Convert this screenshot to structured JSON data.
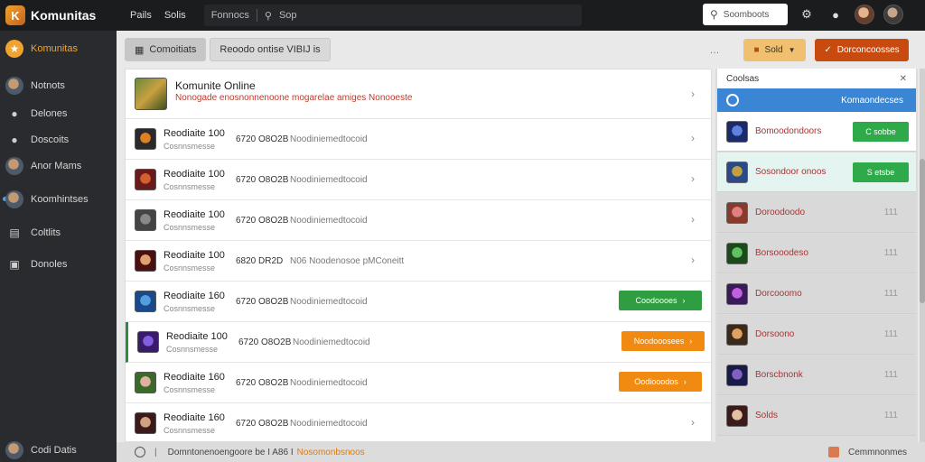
{
  "app": {
    "name": "Komunitas",
    "logo_letter": "K"
  },
  "topnav": [
    "Pails",
    "Solis",
    "Fonnocs"
  ],
  "topsearch": {
    "placeholder": "Sop"
  },
  "search": {
    "placeholder": "Soomboots"
  },
  "sidebar": {
    "items": [
      {
        "label": "Komunitas",
        "icon": "community-logo-icon"
      },
      {
        "label": "Notnots",
        "icon": "avatar-icon"
      },
      {
        "label": "Delones",
        "icon": "user-icon"
      },
      {
        "label": "Doscoits",
        "icon": "users-icon"
      },
      {
        "label": "Anor Mams",
        "icon": "avatar-icon"
      },
      {
        "label": "Koomhintses",
        "icon": "avatar-icon"
      },
      {
        "label": "Coltlits",
        "icon": "document-icon"
      },
      {
        "label": "Donoles",
        "icon": "folder-icon"
      }
    ],
    "footer": "Codi Datis"
  },
  "tabs": [
    {
      "label": "Comoitiats"
    },
    {
      "label": "Reoodo ontise VIBIJ is"
    }
  ],
  "header_buttons": {
    "sold_label": "Sold",
    "primary_label": "Dorconcoosses"
  },
  "main": {
    "title": "Komunite Online",
    "subtitle": "Nonogade enosnonnenoone mogarelae amiges Nonooeste",
    "rows": [
      {
        "name": "Reodiaite 100",
        "sub": "Cosnnsmesse",
        "time": "6720 O8O2B",
        "desc": "Noodiniemedtocoid",
        "button": null
      },
      {
        "name": "Reodiaite 100",
        "sub": "Cosnnsmesse",
        "time": "6720 O8O2B",
        "desc": "Noodiniemedtocoid",
        "button": null
      },
      {
        "name": "Reodiaite 100",
        "sub": "Cosnnsmesse",
        "time": "6720 O8O2B",
        "desc": "Noodiniemedtocoid",
        "button": null
      },
      {
        "name": "Reodiaite 100",
        "sub": "Cosnnsmesse",
        "time": "6820 DR2D",
        "desc": "N06 Noodenosoe pMConeitt",
        "button": null
      },
      {
        "name": "Reodiaite 160",
        "sub": "Cosnnsmesse",
        "time": "6720 O8O2B",
        "desc": "Noodiniemedtocoid",
        "button": {
          "label": "Coodoooes",
          "color": "#2e9e40"
        }
      },
      {
        "name": "Reodiaite 100",
        "sub": "Cosnnsmesse",
        "time": "6720 O8O2B",
        "desc": "Noodiniemedtocoid",
        "button": {
          "label": "Noodooosees",
          "color": "#f08a10"
        }
      },
      {
        "name": "Reodiaite 160",
        "sub": "Cosnnsmesse",
        "time": "6720 O8O2B",
        "desc": "Noodiniemedtocoid",
        "button": {
          "label": "Oodiooodos",
          "color": "#f08a10"
        }
      },
      {
        "name": "Reodiaite 160",
        "sub": "Cosnnsmesse",
        "time": "6720 O8O2B",
        "desc": "Noodiniemedtocoid",
        "button": null
      }
    ]
  },
  "right": {
    "head": "Coolsas",
    "blue_label": "Komaondecses",
    "items": [
      {
        "name": "Bomoodondoors",
        "button": "C sobbe",
        "highlight": false
      },
      {
        "name": "Sosondoor onoos",
        "button": "S etsbe",
        "highlight": true
      },
      {
        "name": "Doroodoodo",
        "count": "111"
      },
      {
        "name": "Borsooodeso",
        "count": "111"
      },
      {
        "name": "Dorcooomo",
        "count": "111"
      },
      {
        "name": "Dorsoono",
        "count": "111"
      },
      {
        "name": "Borscbnonk",
        "count": "111"
      },
      {
        "name": "Solds",
        "count": "111"
      }
    ]
  },
  "bottom": {
    "left_text": "Domntonenoengoore be I A86 I",
    "left_accent": "Nosomonbsnoos",
    "right_text": "Cemmnonmes"
  },
  "colors": {
    "accent": "#f0a330",
    "brand_dark": "#1b1c1e",
    "sidebar": "#2a2b2e",
    "green": "#2e9e40",
    "orange": "#f08a10",
    "blue": "#3a86d4",
    "danger": "#c0392b"
  }
}
